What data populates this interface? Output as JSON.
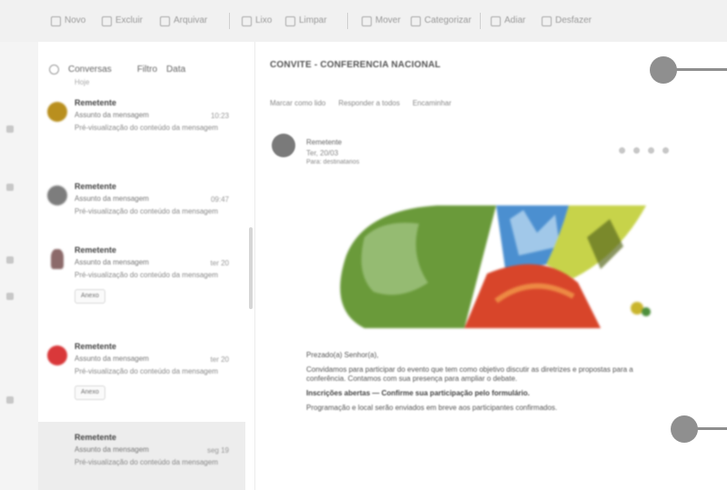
{
  "toolbar": {
    "items": [
      {
        "label": "Novo",
        "icon": "new-mail-icon"
      },
      {
        "label": "Excluir",
        "icon": "delete-icon"
      },
      {
        "label": "Arquivar",
        "icon": "archive-icon"
      },
      {
        "label": "Lixo",
        "icon": "junk-icon"
      },
      {
        "label": "Limpar",
        "icon": "sweep-icon"
      },
      {
        "label": "Mover",
        "icon": "move-icon"
      },
      {
        "label": "Categorizar",
        "icon": "tag-icon"
      },
      {
        "label": "Adiar",
        "icon": "clock-icon"
      },
      {
        "label": "Desfazer",
        "icon": "undo-icon"
      }
    ]
  },
  "mail_list": {
    "header_label": "Conversas",
    "filter_label": "Filtro",
    "sort_label": "Data",
    "sub_label": "Hoje",
    "items": [
      {
        "sender": "Remetente",
        "subject": "Assunto da mensagem",
        "time": "10:23",
        "preview": "Pré-visualização do conteúdo da mensagem",
        "avatar_color": "#b98f1e",
        "chip": ""
      },
      {
        "sender": "Remetente",
        "subject": "Assunto da mensagem",
        "time": "09:47",
        "preview": "Pré-visualização do conteúdo da mensagem",
        "avatar_color": "#7d7d7d",
        "chip": ""
      },
      {
        "sender": "Remetente",
        "subject": "Assunto da mensagem",
        "time": "ter 20",
        "preview": "Pré-visualização do conteúdo da mensagem",
        "avatar_color": "#8c6a6a",
        "chip": "Anexo"
      },
      {
        "sender": "Remetente",
        "subject": "Assunto da mensagem",
        "time": "ter 20",
        "preview": "Pré-visualização do conteúdo da mensagem",
        "avatar_color": "#d9383a",
        "chip": "Anexo"
      },
      {
        "sender": "Remetente",
        "subject": "Assunto da mensagem",
        "time": "seg 19",
        "preview": "Pré-visualização do conteúdo da mensagem",
        "avatar_color": "",
        "chip": ""
      }
    ]
  },
  "reading": {
    "subject": "CONVITE - CONFERENCIA NACIONAL",
    "thread_items": [
      "Marcar como lido",
      "Responder a todos",
      "Encaminhar"
    ],
    "from": "Remetente",
    "date": "Ter, 20/03",
    "to": "Para: destinatarios",
    "body": [
      {
        "text": "Prezado(a) Senhor(a),",
        "bold": false
      },
      {
        "text": "Convidamos para participar do evento que tem como objetivo discutir as diretrizes e propostas para a conferência. Contamos com sua presença para ampliar o debate.",
        "bold": false
      },
      {
        "text": "Inscrições abertas — Confirme sua participação pelo formulário.",
        "bold": true
      },
      {
        "text": "Programação e local serão enviados em breve aos participantes confirmados.",
        "bold": false
      }
    ]
  },
  "colors": {
    "toolbar_bg": "#f1f1f1",
    "selected_bg": "#ededed",
    "pointer": "#8f8f8f"
  }
}
